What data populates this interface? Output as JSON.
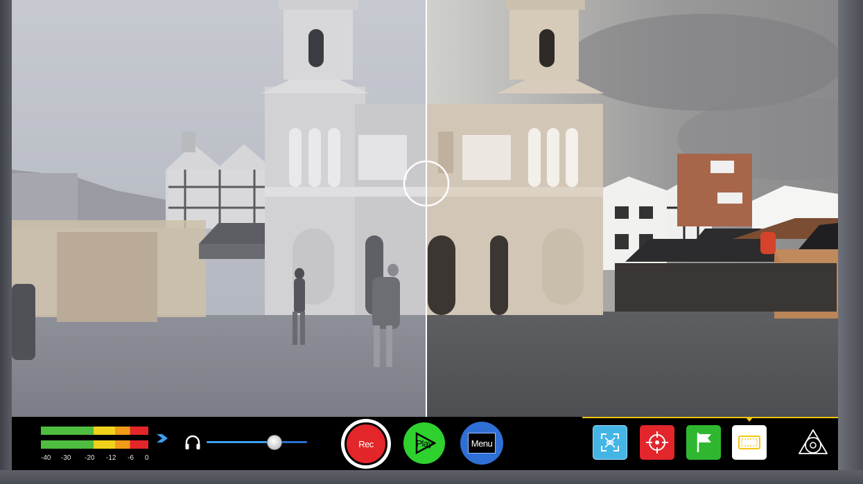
{
  "screen": {
    "split_view": {
      "left_look": "log",
      "right_look": "graded"
    }
  },
  "audio_meter": {
    "scale": [
      "-40",
      "-30",
      "-20",
      "-12",
      "-6",
      "0"
    ],
    "icon": "chevron-right-icon"
  },
  "volume": {
    "icon": "headphone-icon",
    "level": 0.67
  },
  "transport": {
    "rec_label": "Rec",
    "play_label": "Play",
    "menu_label": "Menu"
  },
  "tools": {
    "items": [
      {
        "name": "focus-peaking-icon",
        "color": "#45b5e6"
      },
      {
        "name": "crosshair-icon",
        "color": "#e2262c"
      },
      {
        "name": "flag-icon",
        "color": "#2fb82f"
      },
      {
        "name": "monitor-overlay-icon",
        "color": "#ffffff",
        "selected": true
      }
    ],
    "selected_accent": "#f3c512"
  },
  "brand": {
    "logo": "atomos-logo-icon"
  }
}
